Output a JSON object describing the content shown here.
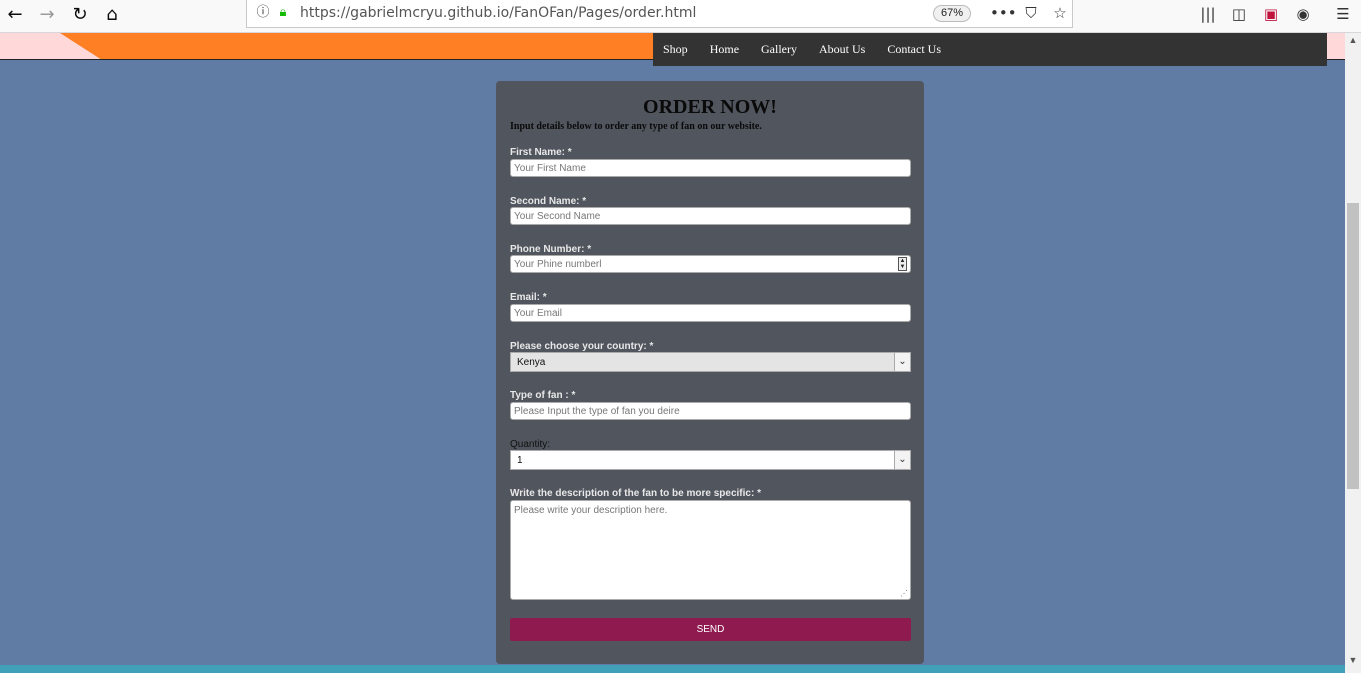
{
  "browser": {
    "url": "https://gabrielmcryu.github.io/FanOFan/Pages/order.html",
    "zoom": "67%",
    "icons": [
      "back-icon",
      "forward-icon",
      "reload-icon",
      "home-icon",
      "info-icon",
      "lock-icon",
      "more-icon",
      "pocket-icon",
      "bookmark-star-icon",
      "library-icon",
      "sidebar-icon",
      "extension-icon",
      "account-icon",
      "menu-icon"
    ]
  },
  "site_nav": [
    "Shop",
    "Home",
    "Gallery",
    "About Us",
    "Contact Us"
  ],
  "form": {
    "title": "ORDER NOW!",
    "subtitle": "Input details below to order any type of fan on our website.",
    "first_name_label": "First Name: *",
    "first_name_placeholder": "Your First Name",
    "second_name_label": "Second Name: *",
    "second_name_placeholder": "Your Second Name",
    "phone_label": "Phone Number: *",
    "phone_placeholder": "Your Phine numberl",
    "email_label": "Email: *",
    "email_placeholder": "Your Email",
    "country_label": "Please choose your country: *",
    "country_value": "Kenya",
    "fan_type_label": "Type of fan : *",
    "fan_type_placeholder": "Please Input the type of fan you deire",
    "quantity_label": "Quantity:",
    "quantity_value": "1",
    "description_label": "Write the description of the fan to be more specific: *",
    "description_placeholder": "Please write your description here.",
    "send_label": "SEND"
  },
  "colors": {
    "page_bg": "#617ca4",
    "card_bg": "#50555e",
    "send_button": "#8e1a4f",
    "nav_bg": "#333333",
    "header_orange": "#ff7f24"
  }
}
